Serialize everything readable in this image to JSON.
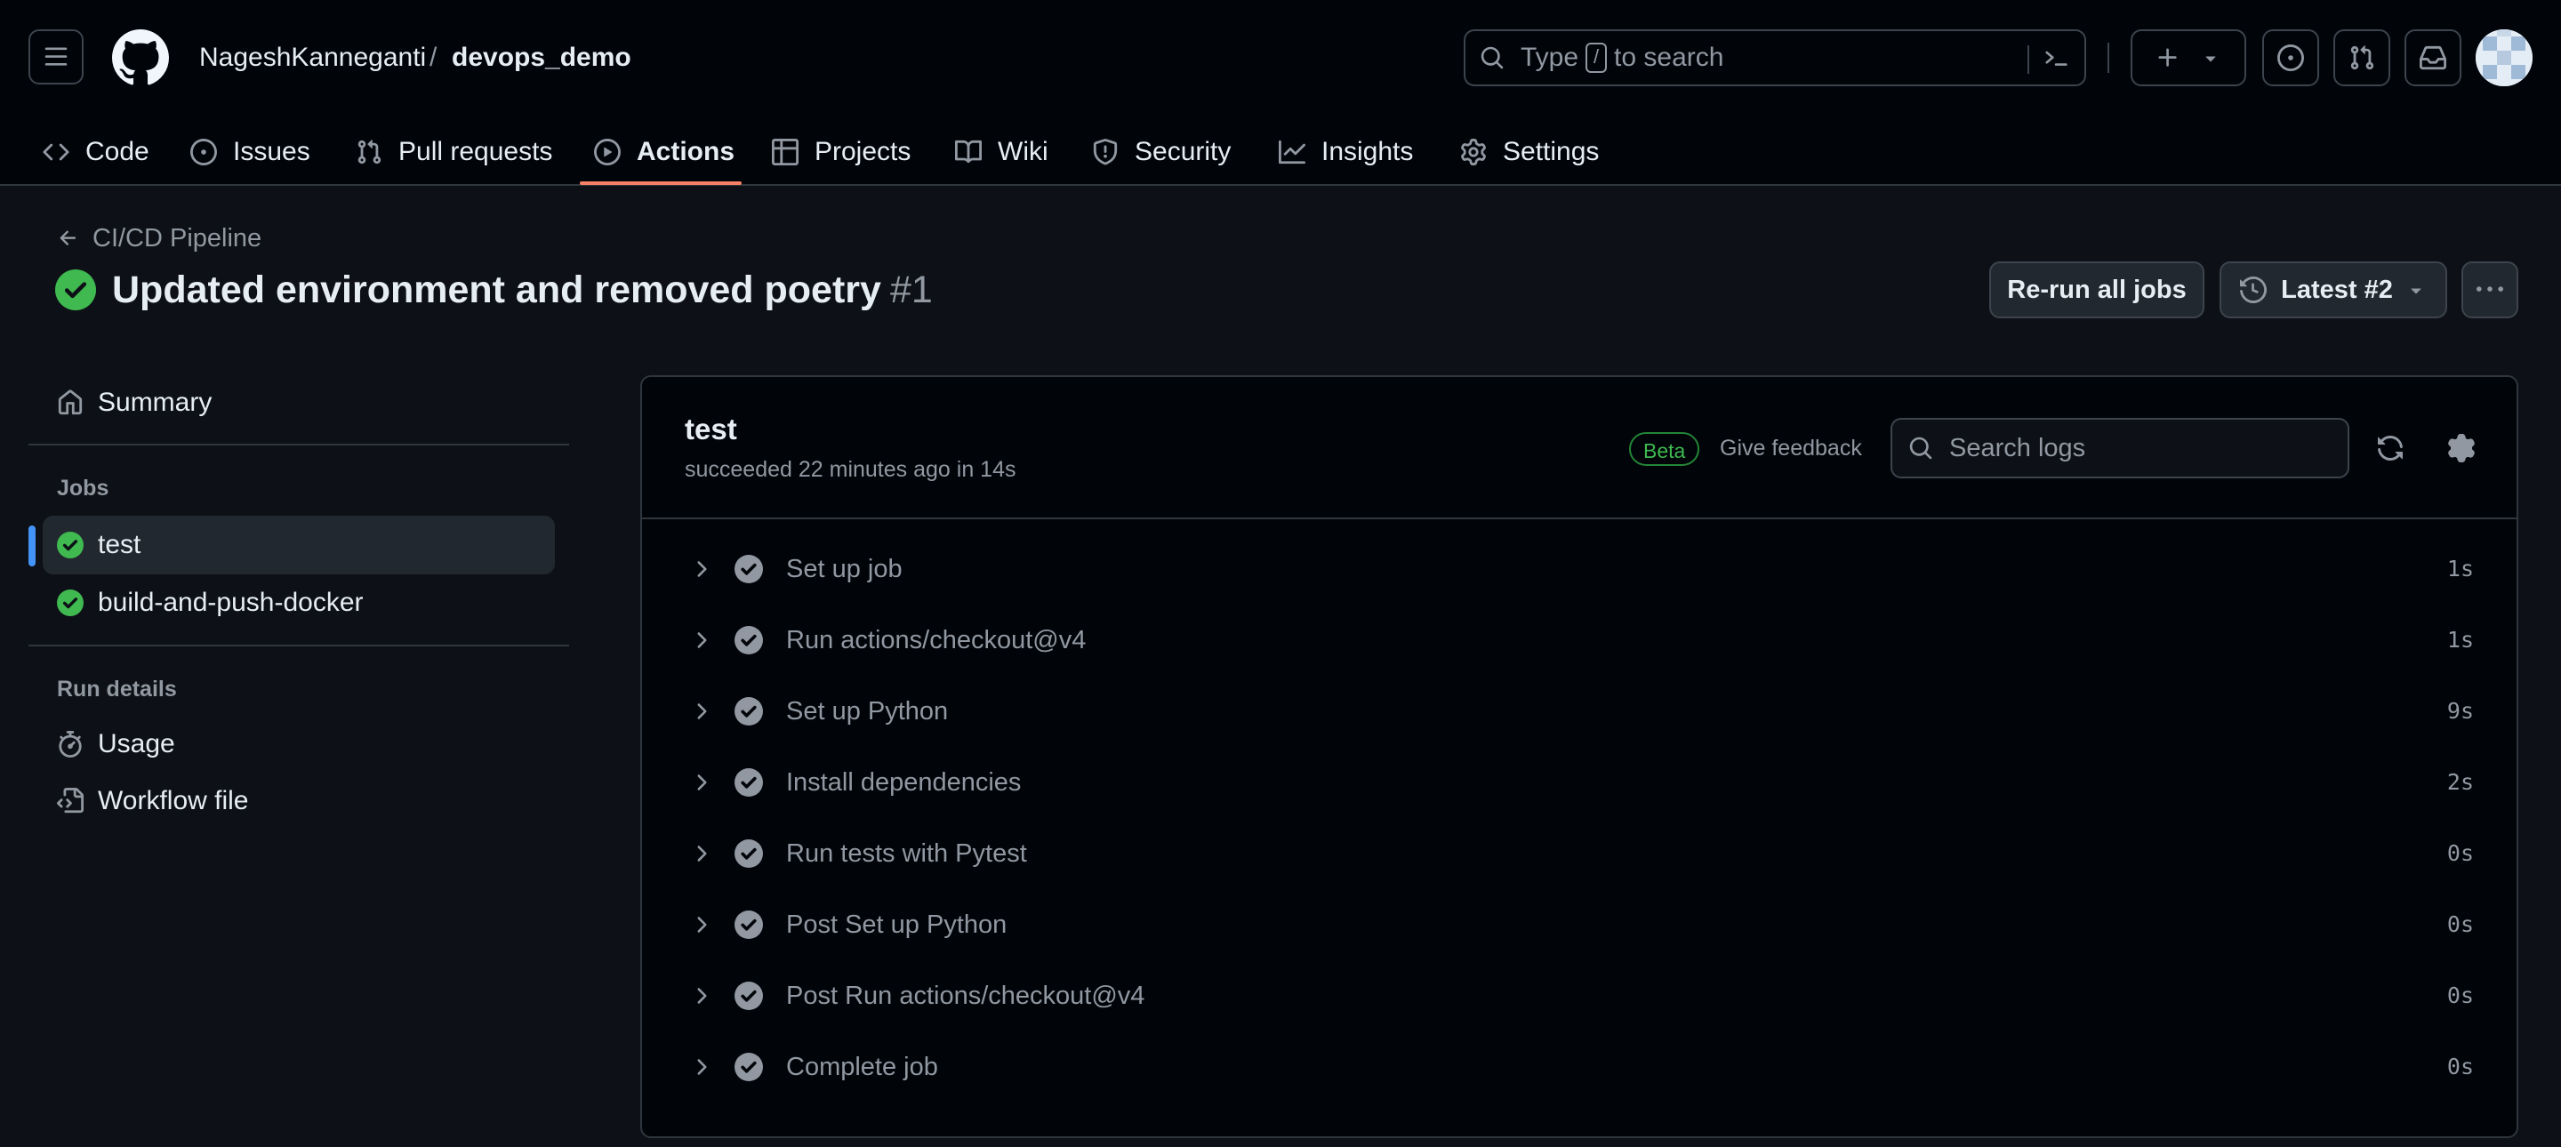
{
  "header": {
    "owner": "NageshKanneganti",
    "separator": "/",
    "repo": "devops_demo",
    "search_prefix": "Type",
    "search_key": "/",
    "search_suffix": "to search"
  },
  "tabs": [
    {
      "label": "Code",
      "icon": "code-icon"
    },
    {
      "label": "Issues",
      "icon": "issue-icon"
    },
    {
      "label": "Pull requests",
      "icon": "pull-request-icon"
    },
    {
      "label": "Actions",
      "icon": "play-icon",
      "active": true
    },
    {
      "label": "Projects",
      "icon": "table-icon"
    },
    {
      "label": "Wiki",
      "icon": "book-icon"
    },
    {
      "label": "Security",
      "icon": "shield-icon"
    },
    {
      "label": "Insights",
      "icon": "graph-icon"
    },
    {
      "label": "Settings",
      "icon": "gear-icon"
    }
  ],
  "run": {
    "back_label": "CI/CD Pipeline",
    "title": "Updated environment and removed poetry",
    "number": "#1",
    "rerun_label": "Re-run all jobs",
    "latest_label": "Latest #2"
  },
  "sidebar": {
    "summary_label": "Summary",
    "jobs_heading": "Jobs",
    "jobs": [
      {
        "label": "test",
        "selected": true
      },
      {
        "label": "build-and-push-docker"
      }
    ],
    "run_details_heading": "Run details",
    "usage_label": "Usage",
    "workflow_label": "Workflow file"
  },
  "job": {
    "name": "test",
    "status": "succeeded 22 minutes ago in 14s",
    "beta_label": "Beta",
    "feedback_label": "Give feedback",
    "search_placeholder": "Search logs",
    "steps": [
      {
        "name": "Set up job",
        "duration": "1s"
      },
      {
        "name": "Run actions/checkout@v4",
        "duration": "1s"
      },
      {
        "name": "Set up Python",
        "duration": "9s"
      },
      {
        "name": "Install dependencies",
        "duration": "2s"
      },
      {
        "name": "Run tests with Pytest",
        "duration": "0s"
      },
      {
        "name": "Post Set up Python",
        "duration": "0s"
      },
      {
        "name": "Post Run actions/checkout@v4",
        "duration": "0s"
      },
      {
        "name": "Complete job",
        "duration": "0s"
      }
    ]
  },
  "colors": {
    "background": "#0d1117",
    "header_bg": "#010409",
    "success": "#3fb950",
    "accent_underline": "#f78166",
    "selected_indicator": "#4493f8"
  }
}
